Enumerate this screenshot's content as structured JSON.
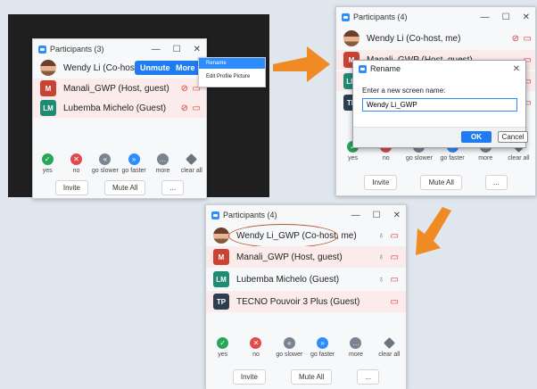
{
  "colors": {
    "accent": "#2d8cff",
    "arrow": "#f08a24",
    "avatar_m": "#c94233",
    "avatar_lm": "#1f8b73",
    "avatar_tp": "#2c3e50",
    "highlight": "#fbeceb"
  },
  "p1": {
    "title": "Participants (3)",
    "rows": [
      {
        "avatar": "",
        "name": "Wendy Li (Co-host, me)"
      },
      {
        "avatar": "M",
        "name": "Manali_GWP (Host, guest)"
      },
      {
        "avatar": "LM",
        "name": "Lubemba Michelo (Guest)"
      }
    ],
    "unmute": "Unmute",
    "more": "More",
    "menu": [
      "Rename",
      "Edit Profile Picture"
    ],
    "reactions": [
      "yes",
      "no",
      "go slower",
      "go faster",
      "more",
      "clear all"
    ],
    "invite": "Invite",
    "mute_all": "Mute All",
    "ellipsis": "..."
  },
  "p2": {
    "title": "Participants (4)",
    "rows": [
      {
        "avatar": "",
        "name": "Wendy Li (Co-host, me)"
      },
      {
        "avatar": "M",
        "name": "Manali_GWP (Host, guest)"
      },
      {
        "avatar": "LM",
        "name": ""
      },
      {
        "avatar": "TP",
        "name": ""
      }
    ],
    "dialog": {
      "title": "Rename",
      "label": "Enter a new screen name:",
      "value": "Wendy Li_GWP",
      "ok": "OK",
      "cancel": "Cancel"
    },
    "reactions": [
      "yes",
      "no",
      "go slower",
      "go faster",
      "more",
      "clear all"
    ],
    "invite": "Invite",
    "mute_all": "Mute All",
    "ellipsis": "..."
  },
  "p3": {
    "title": "Participants (4)",
    "rows": [
      {
        "avatar": "",
        "name": "Wendy Li_GWP (Co-host, me)"
      },
      {
        "avatar": "M",
        "name": "Manali_GWP (Host, guest)"
      },
      {
        "avatar": "LM",
        "name": "Lubemba Michelo (Guest)"
      },
      {
        "avatar": "TP",
        "name": "TECNO Pouvoir 3 Plus (Guest)"
      }
    ],
    "reactions": [
      "yes",
      "no",
      "go slower",
      "go faster",
      "more",
      "clear all"
    ],
    "invite": "Invite",
    "mute_all": "Mute All",
    "ellipsis": "..."
  }
}
